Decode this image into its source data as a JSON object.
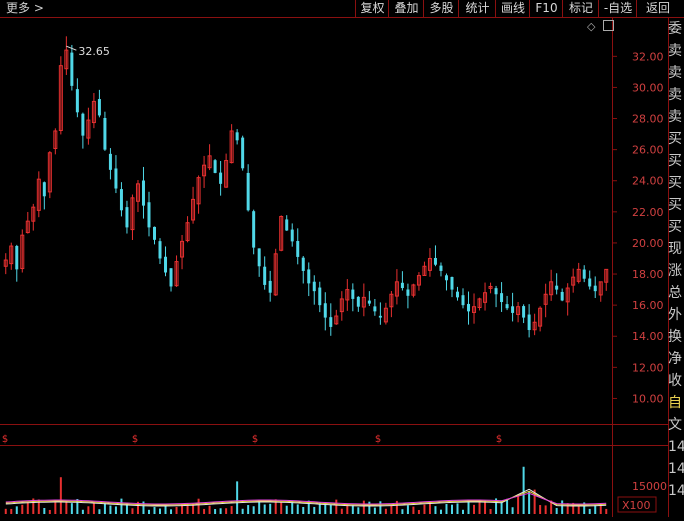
{
  "toolbar": {
    "more": "更多 >",
    "buttons": [
      "复权",
      "叠加",
      "多股",
      "统计",
      "画线",
      "F10",
      "标记",
      "-自选",
      "返回"
    ]
  },
  "price_chart": {
    "high_marker": "32.65",
    "y_ticks": [
      "32.00",
      "30.00",
      "28.00",
      "26.00",
      "24.00",
      "22.00",
      "20.00",
      "18.00",
      "16.00",
      "14.00",
      "12.00",
      "10.00"
    ],
    "event_marker": "$"
  },
  "volume_chart": {
    "tick_label": "15000",
    "unit_label": "X100"
  },
  "side_panel": [
    "委",
    "卖",
    "卖",
    "卖",
    "卖",
    "买",
    "买",
    "买",
    "买",
    "买",
    "现",
    "涨",
    "总",
    "外",
    "换",
    "净",
    "收",
    "自",
    "文",
    "14",
    "14",
    "14"
  ],
  "colors": {
    "up": "#e83030",
    "down": "#50d8e8",
    "grid": "#8a1010",
    "axis_text": "#d04040",
    "ma_white": "#e8e8e8",
    "ma_yellow": "#e8d040",
    "ma_magenta": "#e040e0"
  },
  "chart_data": {
    "type": "candlestick",
    "y_range": [
      9.0,
      33.5
    ],
    "close_series": [
      18.9,
      19.8,
      18.3,
      20.5,
      21.4,
      22.3,
      24.1,
      23.0,
      25.8,
      27.2,
      31.4,
      32.4,
      30.1,
      28.4,
      26.9,
      27.9,
      29.1,
      28.2,
      26.0,
      24.7,
      23.5,
      22.1,
      21.0,
      22.9,
      23.8,
      22.4,
      21.0,
      20.2,
      19.0,
      18.1,
      17.2,
      18.8,
      20.1,
      21.3,
      22.8,
      24.2,
      25.0,
      25.6,
      24.5,
      23.8,
      25.3,
      27.2,
      26.6,
      24.8,
      22.1,
      19.7,
      18.5,
      17.3,
      16.8,
      19.3,
      21.7,
      20.8,
      20.1,
      19.1,
      18.2,
      17.4,
      16.9,
      16.0,
      15.2,
      14.6,
      15.3,
      16.4,
      17.0,
      16.4,
      15.9,
      16.5,
      16.1,
      15.6,
      15.2,
      15.8,
      16.7,
      17.5,
      17.1,
      16.6,
      17.3,
      17.9,
      18.5,
      19.0,
      18.6,
      18.2,
      17.6,
      17.0,
      16.5,
      16.0,
      15.6,
      15.9,
      16.4,
      16.8,
      17.2,
      16.7,
      16.2,
      15.8,
      15.5,
      15.9,
      15.2,
      14.4,
      14.9,
      15.8,
      16.7,
      17.5,
      17.0,
      16.3,
      17.1,
      17.8,
      18.3,
      17.7,
      17.2,
      16.9,
      17.5,
      18.3
    ]
  }
}
